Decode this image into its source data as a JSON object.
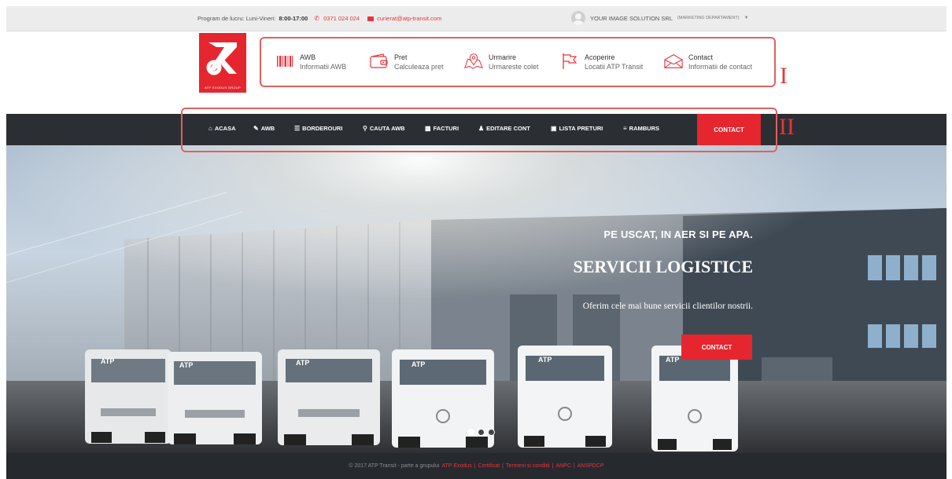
{
  "topbar": {
    "hours_label": "Program de lucru: Luni-Vineri:",
    "hours_value": "8:00-17:00",
    "phone": "0371 024 024",
    "email": "curierat@atp-transit.com",
    "company": "YOUR IMAGE SOLUTION SRL",
    "department": "(MARKETING DEPARTAMENT)"
  },
  "logo": {
    "text": "ATP EXODUS GROUP"
  },
  "info_items": [
    {
      "title": "AWB",
      "subtitle": "Informatii AWB",
      "icon": "barcode-icon"
    },
    {
      "title": "Pret",
      "subtitle": "Calculeaza pret",
      "icon": "wallet-icon"
    },
    {
      "title": "Urmarire",
      "subtitle": "Urmareste colet",
      "icon": "map-pin-icon"
    },
    {
      "title": "Acoperire",
      "subtitle": "Locatii ATP Transit",
      "icon": "flag-icon"
    },
    {
      "title": "Contact",
      "subtitle": "Informatii de contact",
      "icon": "envelope-icon"
    }
  ],
  "annotations": {
    "box1": "I",
    "box2": "II"
  },
  "nav": {
    "items": [
      {
        "label": "ACASA",
        "icon": "home-icon"
      },
      {
        "label": "AWB",
        "icon": "pencil-icon"
      },
      {
        "label": "BORDEROURI",
        "icon": "list-icon"
      },
      {
        "label": "CAUTA AWB",
        "icon": "search-icon"
      },
      {
        "label": "FACTURI",
        "icon": "invoice-icon"
      },
      {
        "label": "EDITARE CONT",
        "icon": "user-icon"
      },
      {
        "label": "LISTA PRETURI",
        "icon": "price-list-icon"
      },
      {
        "label": "RAMBURS",
        "icon": "menu-icon"
      }
    ],
    "contact": "CONTACT"
  },
  "hero": {
    "line1": "PE USCAT, IN AER SI PE APA.",
    "line2": "SERVICII LOGISTICE",
    "line3": "Oferim cele mai bune servicii clientilor nostrii.",
    "button": "CONTACT",
    "truck_brand": "ATP",
    "slides": 3,
    "active_slide": 1
  },
  "footer": {
    "copyright": "© 2017 ATP Transit - parte a grupului",
    "links": [
      "ATP Exodus",
      "Certificat",
      "Termeni si conditii",
      "ANPC",
      "ANSPDCP"
    ]
  },
  "colors": {
    "accent": "#e5262f",
    "nav_bg": "#2b2e33",
    "footer_bg": "#26292e",
    "annotation": "#e06060"
  }
}
